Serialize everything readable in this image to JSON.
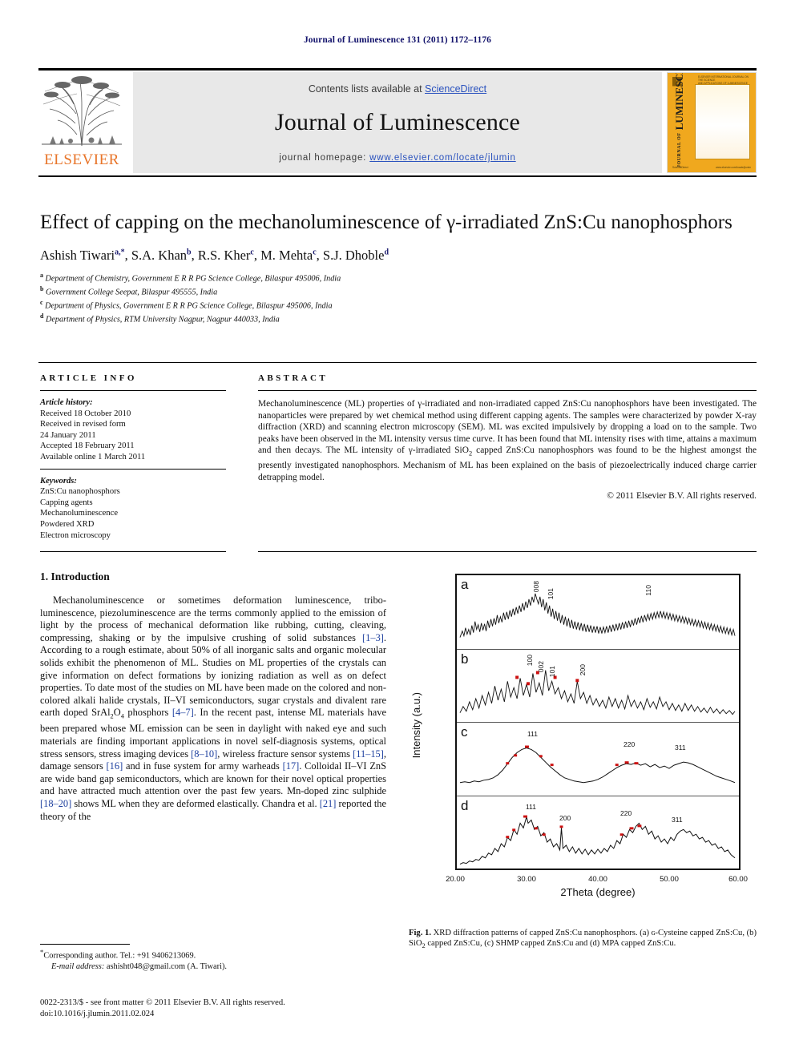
{
  "running_head": "Journal of Luminescence 131 (2011) 1172–1176",
  "masthead": {
    "contents_prefix": "Contents lists available at ",
    "sciencedirect": "ScienceDirect",
    "journal_title": "Journal of Luminescence",
    "homepage_prefix": "journal homepage: ",
    "homepage_url": "www.elsevier.com/locate/jlumin",
    "publisher": "ELSEVIER",
    "cover_title": "JOURNAL OF LUMINESCENCE",
    "accent_orange": "#F0A81E",
    "link_blue": "#2a52be"
  },
  "article": {
    "title": "Effect of capping on the mechanoluminescence of γ-irradiated ZnS:Cu nanophosphors",
    "authors": [
      {
        "name": "Ashish Tiwari",
        "marks": "a,*"
      },
      {
        "name": "S.A. Khan",
        "marks": "b"
      },
      {
        "name": "R.S. Kher",
        "marks": "c"
      },
      {
        "name": "M. Mehta",
        "marks": "c"
      },
      {
        "name": "S.J. Dhoble",
        "marks": "d"
      }
    ],
    "affiliations": [
      {
        "mark": "a",
        "text": "Department of Chemistry, Government E R R PG Science College, Bilaspur 495006, India"
      },
      {
        "mark": "b",
        "text": "Government College Seepat, Bilaspur 495555, India"
      },
      {
        "mark": "c",
        "text": "Department of Physics, Government E R R PG Science College, Bilaspur 495006, India"
      },
      {
        "mark": "d",
        "text": "Department of Physics, RTM University Nagpur, Nagpur 440033, India"
      }
    ]
  },
  "article_info": {
    "heading": "ARTICLE INFO",
    "history_label": "Article history:",
    "history": [
      "Received 18 October 2010",
      "Received in revised form",
      "24 January 2011",
      "Accepted 18 February 2011",
      "Available online 1 March 2011"
    ],
    "keywords_label": "Keywords:",
    "keywords": [
      "ZnS:Cu nanophosphors",
      "Capping agents",
      "Mechanoluminescence",
      "Powdered XRD",
      "Electron microscopy"
    ]
  },
  "abstract": {
    "heading": "ABSTRACT",
    "text": "Mechanoluminescence (ML) properties of γ-irradiated and non-irradiated capped ZnS:Cu nanophosphors have been investigated. The nanoparticles were prepared by wet chemical method using different capping agents. The samples were characterized by powder X-ray diffraction (XRD) and scanning electron microscopy (SEM). ML was excited impulsively by dropping a load on to the sample. Two peaks have been observed in the ML intensity versus time curve. It has been found that ML intensity rises with time, attains a maximum and then decays. The ML intensity of γ-irradiated SiO2 capped ZnS:Cu nanophosphors was found to be the highest amongst the presently investigated nanophosphors. Mechanism of ML has been explained on the basis of piezoelectrically induced charge carrier detrapping model.",
    "copyright": "© 2011 Elsevier B.V. All rights reserved."
  },
  "introduction": {
    "heading": "1.  Introduction",
    "paragraph": "Mechanoluminescence or sometimes deformation luminescence, tribo-luminescence, piezoluminescence are the terms commonly applied to the emission of light by the process of mechanical deformation like rubbing, cutting, cleaving, compressing, shaking or by the impulsive crushing of solid substances [1–3]. According to a rough estimate, about 50% of all inorganic salts and organic molecular solids exhibit the phenomenon of ML. Studies on ML properties of the crystals can give information on defect formations by ionizing radiation as well as on defect properties. To date most of the studies on ML have been made on the colored and non-colored alkali halide crystals, II–VI semiconductors, sugar crystals and divalent rare earth doped SrAl2O4 phosphors [4–7]. In the recent past, intense ML materials have been prepared whose ML emission can be seen in daylight with naked eye and such materials are finding important applications in novel self-diagnosis systems, optical stress sensors, stress imaging devices [8–10], wireless fracture sensor systems [11–15], damage sensors [16] and in fuse system for army warheads [17]. Colloidal II–VI ZnS are wide band gap semiconductors, which are known for their novel optical properties and have attracted much attention over the past few years. Mn-doped zinc sulphide [18–20] shows ML when they are deformed elastically. Chandra et al. [21] reported the theory of the"
  },
  "footnote": {
    "corresponding": "Corresponding author. Tel.: +91 9406213069.",
    "email_label": "E-mail address:",
    "email": "ashisht048@gmail.com (A. Tiwari).",
    "issn_line": "0022-2313/$ - see front matter © 2011 Elsevier B.V. All rights reserved.",
    "doi_line": "doi:10.1016/j.jlumin.2011.02.024"
  },
  "figure": {
    "caption_label": "Fig. 1.",
    "caption": "XRD diffraction patterns of capped ZnS:Cu nanophosphors. (a) ʟ-Cysteine capped ZnS:Cu, (b) SiO2 capped ZnS:Cu, (c) SHMP capped ZnS:Cu and (d) MPA capped ZnS:Cu."
  },
  "chart_data": {
    "type": "line",
    "title": "XRD diffraction patterns of capped ZnS:Cu nanophosphors",
    "xlabel": "2Theta (degree)",
    "ylabel": "Intensity (a.u.)",
    "xlim": [
      20.0,
      60.0
    ],
    "xticks": [
      "20.00",
      "30.00",
      "40.00",
      "50.00",
      "60.00"
    ],
    "xtick_values": [
      20.0,
      30.0,
      40.0,
      50.0,
      60.0
    ],
    "grid": false,
    "legend": "none",
    "marker_color": "#cc1111",
    "line_color": "#111111",
    "panels": [
      {
        "letter": "a",
        "sample": "ʟ-Cysteine capped ZnS:Cu",
        "peak_labels": [
          {
            "hkl": "008",
            "two_theta": 28.3
          },
          {
            "hkl": "101",
            "two_theta": 30.1
          },
          {
            "hkl": "110",
            "two_theta": 47.6
          }
        ],
        "noise": "high",
        "character": "broad amorphous halos at ~28.3 and ~47.6 degrees"
      },
      {
        "letter": "b",
        "sample": "SiO2 capped ZnS:Cu",
        "peak_labels": [
          {
            "hkl": "100",
            "two_theta": 27.0
          },
          {
            "hkl": "002",
            "two_theta": 28.6
          },
          {
            "hkl": "101",
            "two_theta": 30.2
          },
          {
            "hkl": "200",
            "two_theta": 33.5
          }
        ],
        "noise": "high",
        "character": "sharp narrow reflections on a declining background"
      },
      {
        "letter": "c",
        "sample": "SHMP capped ZnS:Cu",
        "peak_labels": [
          {
            "hkl": "111",
            "two_theta": 28.6
          },
          {
            "hkl": "220",
            "two_theta": 47.6
          },
          {
            "hkl": "311",
            "two_theta": 56.4
          }
        ],
        "noise": "low",
        "character": "three broad cubic-phase reflections"
      },
      {
        "letter": "d",
        "sample": "MPA capped ZnS:Cu",
        "peak_labels": [
          {
            "hkl": "111",
            "two_theta": 28.6
          },
          {
            "hkl": "200",
            "two_theta": 33.2
          },
          {
            "hkl": "220",
            "two_theta": 47.8
          },
          {
            "hkl": "311",
            "two_theta": 56.6
          }
        ],
        "noise": "medium",
        "character": "cubic reflections with an extra sharp 200 spike"
      }
    ]
  }
}
